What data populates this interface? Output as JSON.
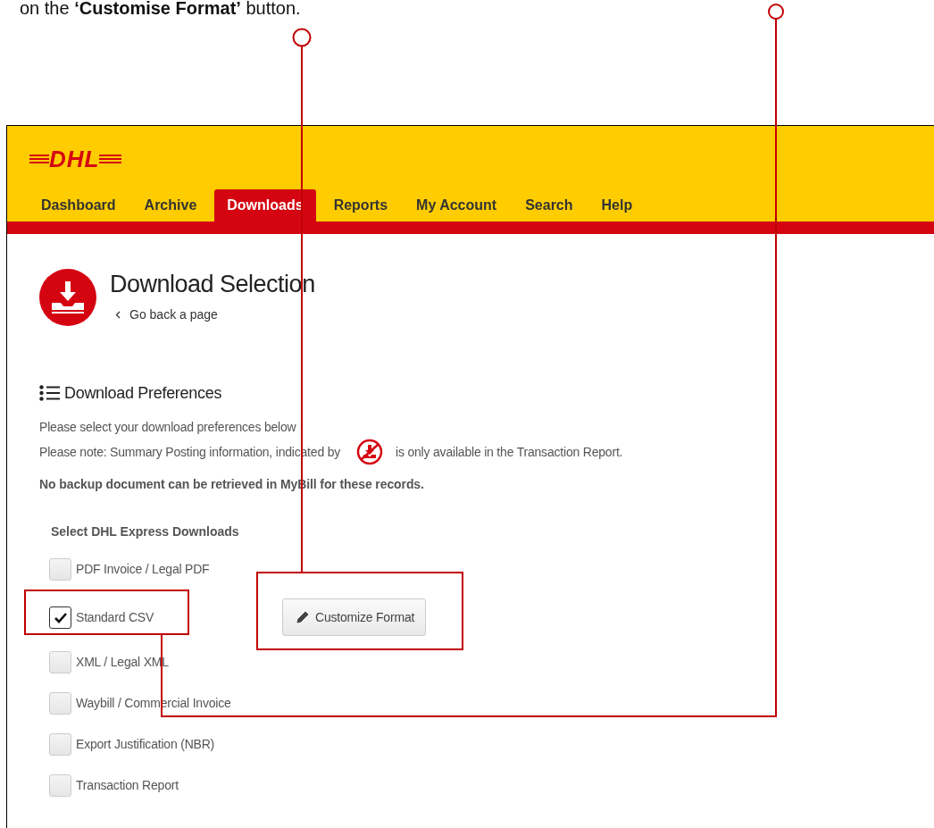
{
  "caption": "on the **‘Customise Format’** button.",
  "header": {
    "logo": "DHL",
    "nav": [
      {
        "label": "Dashboard",
        "selected": false
      },
      {
        "label": "Archive",
        "selected": false
      },
      {
        "label": "Downloads",
        "selected": true
      },
      {
        "label": "Reports",
        "selected": false
      },
      {
        "label": "My Account",
        "selected": false
      },
      {
        "label": "Search",
        "selected": false
      },
      {
        "label": "Help",
        "selected": false
      }
    ]
  },
  "page": {
    "title": "Download Selection",
    "back_link": "Go back a page",
    "preferences": {
      "heading": "Download Preferences",
      "lines": [
        "Please select your download preferences below"
      ],
      "note_before": "Please note: Summary Posting information, indicated by",
      "note_after": "is only available in the Transaction Report.",
      "warning": "No backup document can be retrieved in MyBill for these records."
    },
    "downloads": {
      "heading": "Select DHL Express Downloads",
      "options": [
        {
          "label": "PDF Invoice / Legal PDF",
          "checked": false
        },
        {
          "label": "Standard CSV",
          "checked": true,
          "button": "Customize Format"
        },
        {
          "label": "XML / Legal XML",
          "checked": false
        },
        {
          "label": "Waybill / Commercial Invoice",
          "checked": false
        },
        {
          "label": "Export Justification (NBR)",
          "checked": false
        },
        {
          "label": "Transaction Report",
          "checked": false
        }
      ]
    }
  }
}
